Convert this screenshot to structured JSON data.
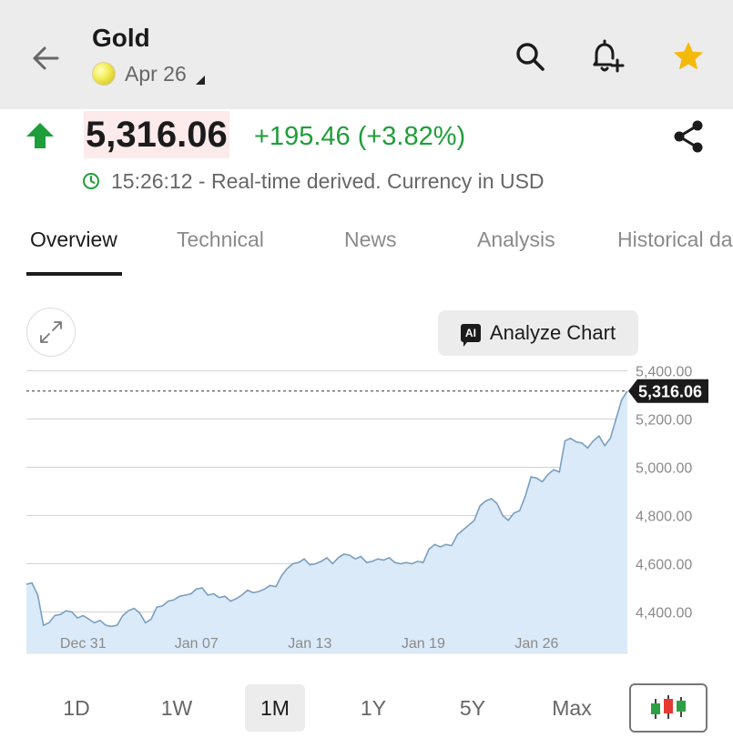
{
  "header": {
    "title": "Gold",
    "contract": "Apr 26"
  },
  "quote": {
    "price": "5,316.06",
    "change": "+195.46 (+3.82%)",
    "time_note": "15:26:12 - Real-time derived. Currency in USD"
  },
  "tabs": [
    {
      "label": "Overview",
      "active": true
    },
    {
      "label": "Technical",
      "active": false
    },
    {
      "label": "News",
      "active": false
    },
    {
      "label": "Analysis",
      "active": false
    },
    {
      "label": "Historical data",
      "active": false
    }
  ],
  "analyze_label": "Analyze Chart",
  "colors": {
    "up": "#1e9e3a",
    "line": "#7a9fc0",
    "fill": "#dbeaf8",
    "star": "#f5b90a",
    "price_highlight": "#fdeaea"
  },
  "icons": {
    "back": "arrow-left-icon",
    "search": "search-icon",
    "alert": "bell-plus-icon",
    "watchlist": "star-icon",
    "share": "share-icon",
    "expand": "expand-icon",
    "clock": "clock-icon",
    "chart_type": "candlestick-icon"
  },
  "ranges": [
    {
      "label": "1D",
      "selected": false
    },
    {
      "label": "1W",
      "selected": false
    },
    {
      "label": "1M",
      "selected": true
    },
    {
      "label": "1Y",
      "selected": false
    },
    {
      "label": "5Y",
      "selected": false
    },
    {
      "label": "Max",
      "selected": false
    }
  ],
  "chart_data": {
    "type": "area",
    "ylim": [
      4300,
      5420
    ],
    "yticks": [
      4400,
      4600,
      4800,
      5000,
      5200,
      5400
    ],
    "ytick_labels": [
      "4,400.00",
      "4,600.00",
      "4,800.00",
      "5,000.00",
      "5,200.00",
      "5,400.00"
    ],
    "xtick_labels": [
      "Dec 31",
      "Jan 07",
      "Jan 13",
      "Jan 19",
      "Jan 26"
    ],
    "xtick_index": [
      10,
      30,
      50,
      70,
      90
    ],
    "last_value": 5316.06,
    "last_value_label": "5,316.06",
    "grid": true,
    "series": [
      {
        "values": [
          4515,
          4520,
          4470,
          4345,
          4355,
          4385,
          4390,
          4405,
          4400,
          4375,
          4385,
          4370,
          4355,
          4365,
          4345,
          4340,
          4345,
          4385,
          4405,
          4415,
          4395,
          4355,
          4370,
          4420,
          4425,
          4445,
          4450,
          4465,
          4470,
          4475,
          4495,
          4500,
          4470,
          4475,
          4460,
          4465,
          4445,
          4455,
          4470,
          4490,
          4480,
          4485,
          4495,
          4510,
          4505,
          4550,
          4580,
          4600,
          4605,
          4620,
          4595,
          4600,
          4610,
          4625,
          4600,
          4625,
          4640,
          4635,
          4620,
          4630,
          4605,
          4610,
          4620,
          4615,
          4625,
          4605,
          4600,
          4605,
          4600,
          4610,
          4605,
          4660,
          4680,
          4670,
          4680,
          4675,
          4720,
          4740,
          4760,
          4780,
          4840,
          4860,
          4870,
          4850,
          4800,
          4780,
          4810,
          4820,
          4880,
          4960,
          4955,
          4940,
          4970,
          4990,
          4980,
          5110,
          5120,
          5105,
          5100,
          5080,
          5110,
          5130,
          5090,
          5120,
          5200,
          5280,
          5316.06
        ]
      }
    ]
  }
}
